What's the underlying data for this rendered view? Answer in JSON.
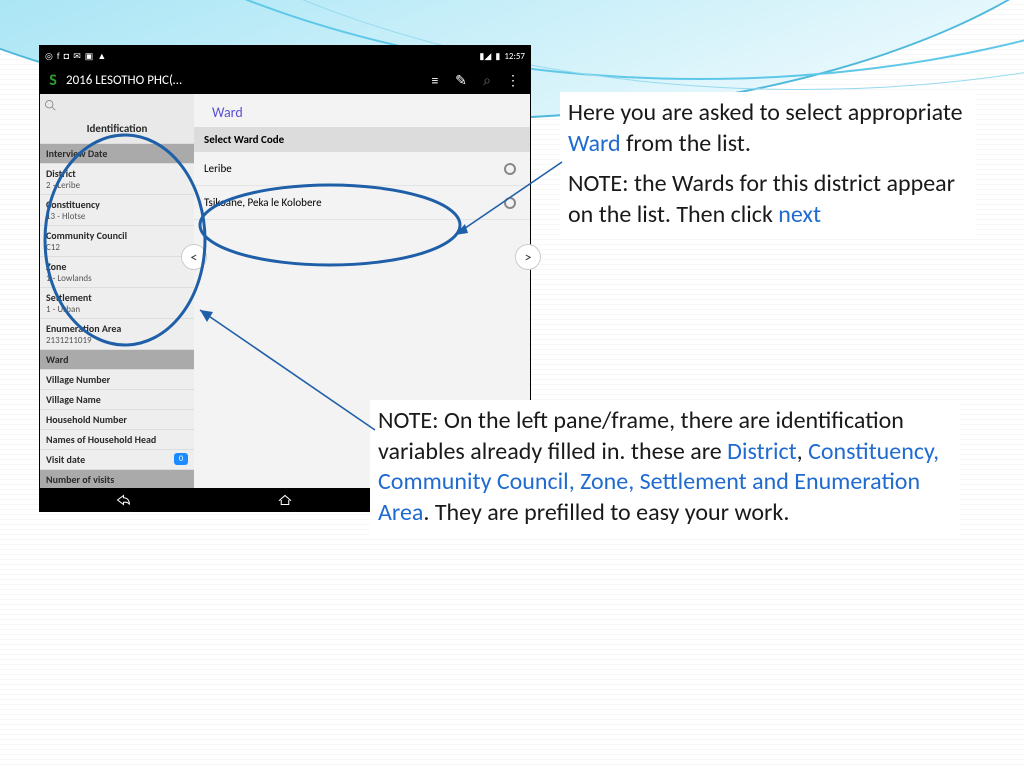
{
  "statusbar": {
    "time": "12:57"
  },
  "appbar": {
    "title": "2016 LESOTHO PHC(…"
  },
  "sidebar": {
    "heading": "Identification",
    "rows": [
      {
        "label": "Interview Date",
        "value": ""
      },
      {
        "label": "District",
        "value": "2 - Leribe"
      },
      {
        "label": "Constituency",
        "value": "13 - Hlotse"
      },
      {
        "label": "Community Council",
        "value": "C12"
      },
      {
        "label": "Zone",
        "value": "1 - Lowlands"
      },
      {
        "label": "Settlement",
        "value": "1 - Urban"
      },
      {
        "label": "Enumeration Area",
        "value": "2131211019"
      },
      {
        "label": "Ward",
        "value": ""
      },
      {
        "label": "Village Number",
        "value": ""
      },
      {
        "label": "Village Name",
        "value": ""
      },
      {
        "label": "Household Number",
        "value": ""
      },
      {
        "label": "Names of Household Head",
        "value": ""
      },
      {
        "label": "Visit date",
        "value": "",
        "badge": "0"
      },
      {
        "label": "Number of visits",
        "value": ""
      }
    ]
  },
  "ward_panel": {
    "title": "Ward",
    "select_label": "Select Ward Code",
    "options": [
      "Leribe",
      "Tsikoane, Peka le Kolobere"
    ]
  },
  "note1": {
    "t1": "Here you are asked to select appropriate ",
    "link1": "Ward",
    "t2": " from the list.",
    "t3": "NOTE: the Wards for this district appear on the list. Then click ",
    "link2": "next"
  },
  "note2": {
    "t1": "NOTE: On the left pane/frame, there are identification variables already filled in. these are ",
    "link1": "District",
    "t2": ", ",
    "link2": "Constituency, Community Council, Zone, Settlement and Enumeration Area",
    "t3": ". They are prefilled to easy your work."
  }
}
